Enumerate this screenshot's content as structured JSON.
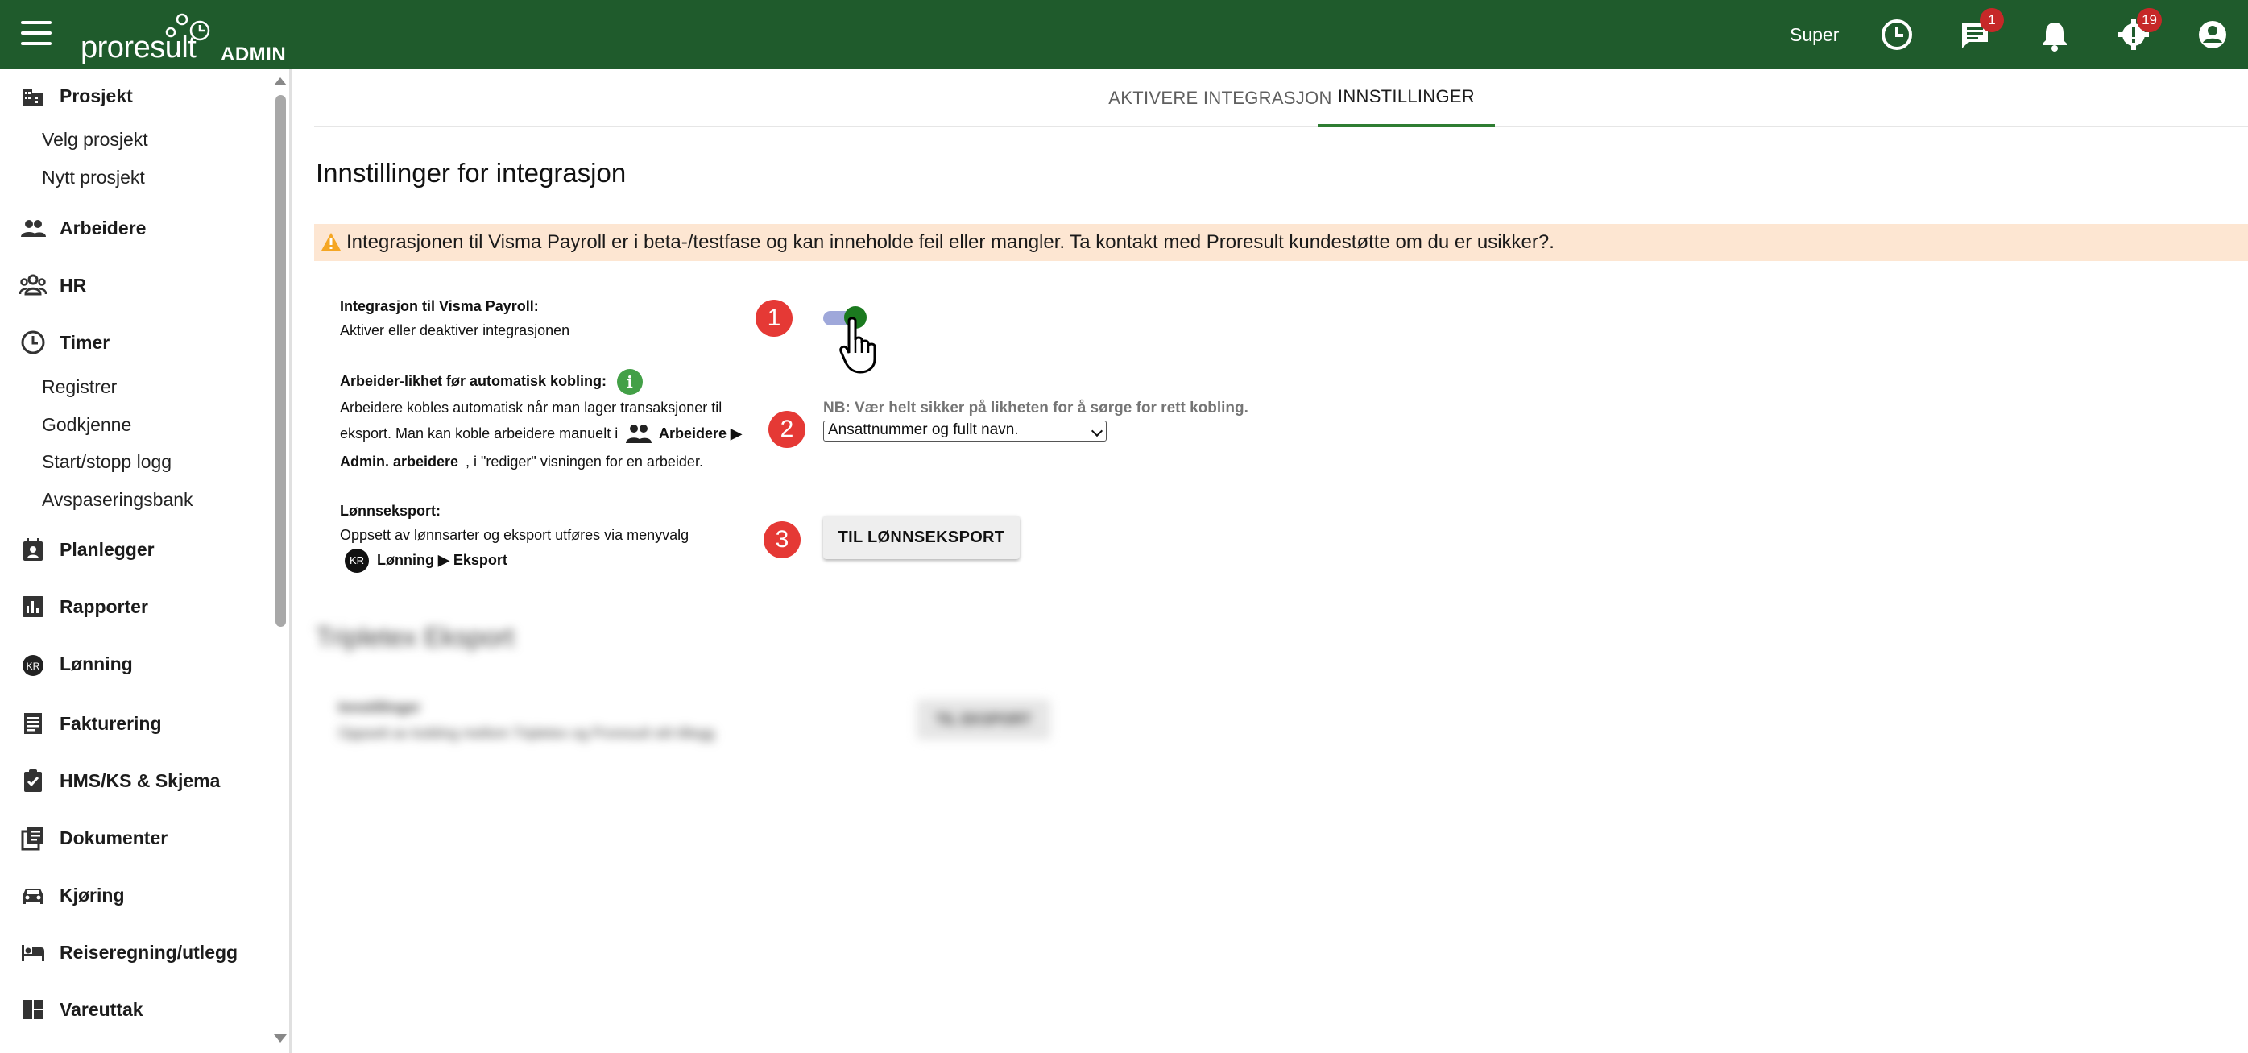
{
  "header": {
    "logo_text": "proresult",
    "logo_suffix": "ADMIN",
    "user_name": "Super",
    "chat_badge": "1",
    "settings_badge": "19",
    "bar_color": "#1f5b2c"
  },
  "sidebar": {
    "items": [
      {
        "label": "Prosjekt",
        "icon": "building-icon"
      },
      {
        "label": "Arbeidere",
        "icon": "people-icon"
      },
      {
        "label": "HR",
        "icon": "group-icon"
      },
      {
        "label": "Timer",
        "icon": "clock-icon"
      },
      {
        "label": "Planlegger",
        "icon": "calendar-icon"
      },
      {
        "label": "Rapporter",
        "icon": "bar-chart-icon"
      },
      {
        "label": "Lønning",
        "icon": "kr-icon"
      },
      {
        "label": "Fakturering",
        "icon": "receipt-icon"
      },
      {
        "label": "HMS/KS & Skjema",
        "icon": "clipboard-check-icon"
      },
      {
        "label": "Dokumenter",
        "icon": "documents-icon"
      },
      {
        "label": "Kjøring",
        "icon": "car-icon"
      },
      {
        "label": "Reiseregning/utlegg",
        "icon": "bed-icon"
      },
      {
        "label": "Vareuttak",
        "icon": "dashboard-icon"
      }
    ],
    "prosjekt_sub": [
      "Velg prosjekt",
      "Nytt prosjekt"
    ],
    "timer_sub": [
      "Registrer",
      "Godkjenne",
      "Start/stopp logg",
      "Avspaseringsbank"
    ]
  },
  "tabs": [
    "AKTIVERE INTEGRASJON",
    "INNSTILLINGER"
  ],
  "page_title": "Innstillinger for integrasjon",
  "warning": "Integrasjonen til Visma Payroll er i beta-/testfase og kan inneholde feil eller mangler. Ta kontakt med Proresult kundestøtte om du er usikker?.",
  "settings": {
    "integration": {
      "title": "Integrasjon til Visma Payroll:",
      "desc": "Aktiver eller deaktiver integrasjonen",
      "enabled": true,
      "step": "1"
    },
    "matching": {
      "title": "Arbeider-likhet før automatisk kobling:",
      "desc_line1": "Arbeidere kobles automatisk når man lager transaksjoner til",
      "desc_line2": "eksport. Man kan koble arbeidere manuelt i",
      "desc_menu": "Arbeidere ▶",
      "desc_line3_bold": "Admin. arbeidere",
      "desc_line3": ", i \"rediger\" visningen for en arbeider.",
      "note": "NB: Vær helt sikker på likheten for å sørge for rett kobling.",
      "selected": "Ansattnummer og fullt navn.",
      "step": "2"
    },
    "export": {
      "title": "Lønnseksport:",
      "desc": "Oppsett av lønnsarter og eksport utføres via menyvalg",
      "menu_path": "Lønning ▶ Eksport",
      "avatar": "KR",
      "button": "TIL LØNNSEKSPORT",
      "step": "3"
    }
  },
  "blurred": {
    "heading": "Tripletex Eksport",
    "row_title": "Innstillinger",
    "row_desc": "Oppsett av kobling mellom Tripletex og Proresult sitt tillegg",
    "button": "TIL EKSPORT"
  }
}
